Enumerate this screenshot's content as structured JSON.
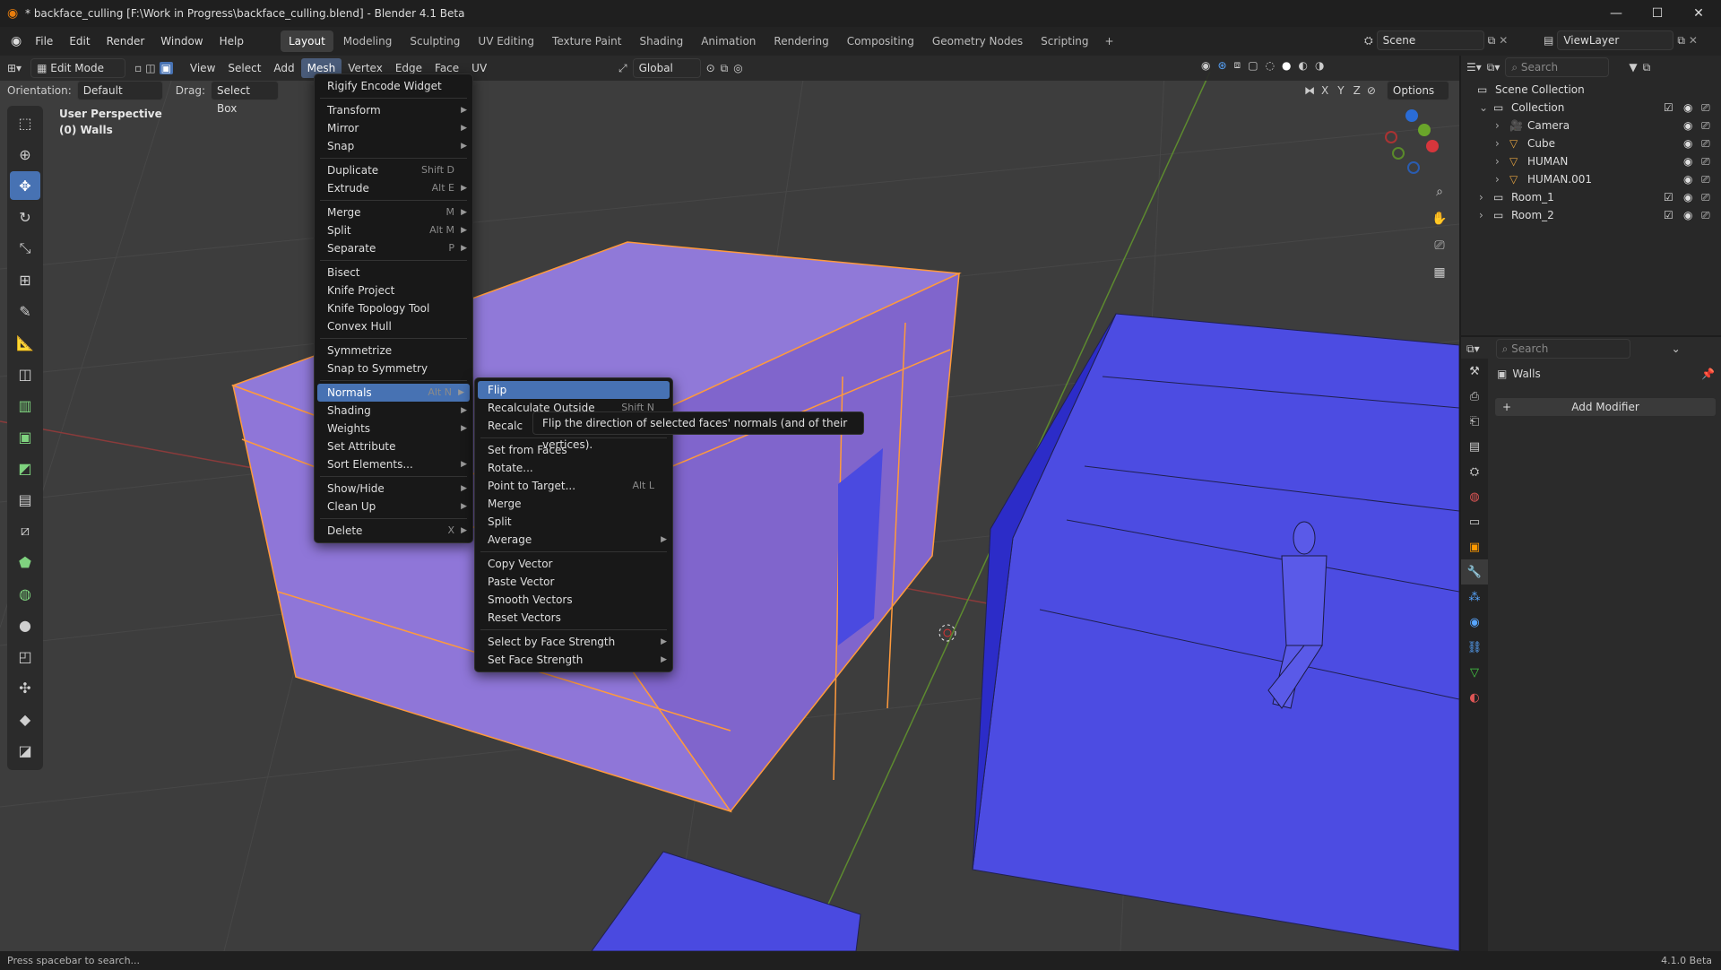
{
  "window": {
    "title": "* backface_culling [F:\\Work in Progress\\backface_culling.blend] - Blender 4.1 Beta",
    "minimize": "—",
    "maximize": "☐",
    "close": "✕"
  },
  "menubar": {
    "items": [
      "File",
      "Edit",
      "Render",
      "Window",
      "Help"
    ],
    "workspaces": [
      "Layout",
      "Modeling",
      "Sculpting",
      "UV Editing",
      "Texture Paint",
      "Shading",
      "Animation",
      "Rendering",
      "Compositing",
      "Geometry Nodes",
      "Scripting"
    ],
    "active_workspace": "Layout",
    "add_workspace": "+",
    "scene": "Scene",
    "view_layer": "ViewLayer"
  },
  "viewport_header": {
    "mode": "Edit Mode",
    "menus": [
      "View",
      "Select",
      "Add",
      "Mesh",
      "Vertex",
      "Edge",
      "Face",
      "UV"
    ],
    "active_menu": "Mesh",
    "transform_orientation": "Global",
    "orientation_label": "Orientation:",
    "orientation_value": "Default",
    "drag_label": "Drag:",
    "drag_value": "Select Box",
    "axes": [
      "X",
      "Y",
      "Z"
    ],
    "options": "Options"
  },
  "overlay_text": {
    "view": "User Perspective",
    "object": "(0) Walls"
  },
  "mesh_menu": {
    "items": [
      {
        "label": "Rigify Encode Widget",
        "shortcut": "",
        "submenu": false,
        "sep_after": true
      },
      {
        "label": "Transform",
        "shortcut": "",
        "submenu": true,
        "sep_after": false
      },
      {
        "label": "Mirror",
        "shortcut": "",
        "submenu": true,
        "sep_after": false
      },
      {
        "label": "Snap",
        "shortcut": "",
        "submenu": true,
        "sep_after": true
      },
      {
        "label": "Duplicate",
        "shortcut": "Shift D",
        "submenu": false,
        "sep_after": false
      },
      {
        "label": "Extrude",
        "shortcut": "Alt E",
        "submenu": true,
        "sep_after": true
      },
      {
        "label": "Merge",
        "shortcut": "M",
        "submenu": true,
        "sep_after": false
      },
      {
        "label": "Split",
        "shortcut": "Alt M",
        "submenu": true,
        "sep_after": false
      },
      {
        "label": "Separate",
        "shortcut": "P",
        "submenu": true,
        "sep_after": true
      },
      {
        "label": "Bisect",
        "shortcut": "",
        "submenu": false,
        "sep_after": false
      },
      {
        "label": "Knife Project",
        "shortcut": "",
        "submenu": false,
        "sep_after": false
      },
      {
        "label": "Knife Topology Tool",
        "shortcut": "",
        "submenu": false,
        "sep_after": false
      },
      {
        "label": "Convex Hull",
        "shortcut": "",
        "submenu": false,
        "sep_after": true
      },
      {
        "label": "Symmetrize",
        "shortcut": "",
        "submenu": false,
        "sep_after": false
      },
      {
        "label": "Snap to Symmetry",
        "shortcut": "",
        "submenu": false,
        "sep_after": true
      },
      {
        "label": "Normals",
        "shortcut": "Alt N",
        "submenu": true,
        "sep_after": false,
        "highlight": true
      },
      {
        "label": "Shading",
        "shortcut": "",
        "submenu": true,
        "sep_after": false
      },
      {
        "label": "Weights",
        "shortcut": "",
        "submenu": true,
        "sep_after": false
      },
      {
        "label": "Set Attribute",
        "shortcut": "",
        "submenu": false,
        "sep_after": false
      },
      {
        "label": "Sort Elements...",
        "shortcut": "",
        "submenu": true,
        "sep_after": true
      },
      {
        "label": "Show/Hide",
        "shortcut": "",
        "submenu": true,
        "sep_after": false
      },
      {
        "label": "Clean Up",
        "shortcut": "",
        "submenu": true,
        "sep_after": true
      },
      {
        "label": "Delete",
        "shortcut": "X",
        "submenu": true,
        "sep_after": false
      }
    ]
  },
  "normals_menu": {
    "items": [
      {
        "label": "Flip",
        "shortcut": "",
        "submenu": false,
        "sep_after": false,
        "highlight": true
      },
      {
        "label": "Recalculate Outside",
        "shortcut": "Shift N",
        "submenu": false,
        "sep_after": false
      },
      {
        "label": "Recalc",
        "shortcut": "",
        "submenu": false,
        "sep_after": true
      },
      {
        "label": "Set from Faces",
        "shortcut": "",
        "submenu": false,
        "sep_after": false
      },
      {
        "label": "Rotate...",
        "shortcut": "",
        "submenu": false,
        "sep_after": false
      },
      {
        "label": "Point to Target...",
        "shortcut": "Alt L",
        "submenu": false,
        "sep_after": false
      },
      {
        "label": "Merge",
        "shortcut": "",
        "submenu": false,
        "sep_after": false
      },
      {
        "label": "Split",
        "shortcut": "",
        "submenu": false,
        "sep_after": false
      },
      {
        "label": "Average",
        "shortcut": "",
        "submenu": true,
        "sep_after": true
      },
      {
        "label": "Copy Vector",
        "shortcut": "",
        "submenu": false,
        "sep_after": false
      },
      {
        "label": "Paste Vector",
        "shortcut": "",
        "submenu": false,
        "sep_after": false
      },
      {
        "label": "Smooth Vectors",
        "shortcut": "",
        "submenu": false,
        "sep_after": false
      },
      {
        "label": "Reset Vectors",
        "shortcut": "",
        "submenu": false,
        "sep_after": true
      },
      {
        "label": "Select by Face Strength",
        "shortcut": "",
        "submenu": true,
        "sep_after": false
      },
      {
        "label": "Set Face Strength",
        "shortcut": "",
        "submenu": true,
        "sep_after": false
      }
    ]
  },
  "tooltip": "Flip the direction of selected faces' normals (and of their vertices).",
  "outliner": {
    "search_placeholder": "Search",
    "rows": [
      {
        "label": "Scene Collection",
        "level": 0
      },
      {
        "label": "Collection",
        "level": 1
      },
      {
        "label": "Camera",
        "level": 2
      },
      {
        "label": "Cube",
        "level": 2
      },
      {
        "label": "HUMAN",
        "level": 2
      },
      {
        "label": "HUMAN.001",
        "level": 2
      },
      {
        "label": "Room_1",
        "level": 1
      },
      {
        "label": "Room_2",
        "level": 1
      }
    ]
  },
  "properties": {
    "search_placeholder": "Search",
    "object_name": "Walls",
    "add_modifier": "Add Modifier"
  },
  "status": {
    "hint": "Press spacebar to search...",
    "version": "4.1.0 Beta"
  },
  "colors": {
    "accent": "#4772b3",
    "selected_mesh": "#8d6ed6",
    "blue_mesh": "#4a4ae0",
    "edge_orange": "#ff9a3c"
  }
}
